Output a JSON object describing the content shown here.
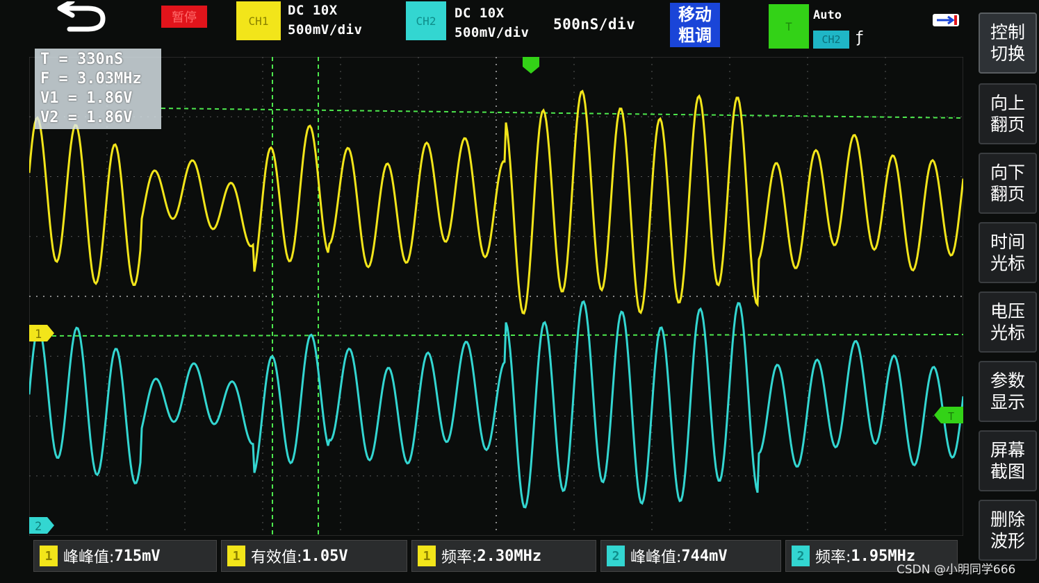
{
  "top_bar": {
    "pause_label": "暂停",
    "ch1_label": "CH1",
    "ch1_coupling": "DC 10X",
    "ch1_scale": "500mV/div",
    "ch2_label": "CH2",
    "ch2_coupling": "DC 10X",
    "ch2_scale": "500mV/div",
    "timebase": "500nS/div",
    "move_mode_line1": "移动",
    "move_mode_line2": "粗调",
    "trigger_label": "T",
    "trigger_mode": "Auto",
    "trigger_source": "CH2",
    "trigger_edge": "ƒ"
  },
  "cursor_readout": {
    "t": "T = 330nS",
    "f": "F = 3.03MHz",
    "v1": "V1 = 1.86V",
    "v2": "V2 = 1.86V"
  },
  "markers": {
    "ch1": "1",
    "ch2": "2",
    "trigger": "T"
  },
  "side_menu": [
    {
      "line1": "控制",
      "line2": "切换"
    },
    {
      "line1": "向上",
      "line2": "翻页"
    },
    {
      "line1": "向下",
      "line2": "翻页"
    },
    {
      "line1": "时间",
      "line2": "光标"
    },
    {
      "line1": "电压",
      "line2": "光标"
    },
    {
      "line1": "参数",
      "line2": "显示"
    },
    {
      "line1": "屏幕",
      "line2": "截图"
    },
    {
      "line1": "删除",
      "line2": "波形"
    }
  ],
  "measurements": [
    {
      "channel": "1",
      "label": "峰峰值:",
      "value": "715mV"
    },
    {
      "channel": "1",
      "label": "有效值:",
      "value": "1.05V"
    },
    {
      "channel": "1",
      "label": "频率:",
      "value": "2.30MHz"
    },
    {
      "channel": "2",
      "label": "峰峰值:",
      "value": "744mV"
    },
    {
      "channel": "2",
      "label": "频率:",
      "value": "1.95MHz"
    }
  ],
  "watermark": "CSDN @小明同学666",
  "colors": {
    "ch1": "#f2e51a",
    "ch2": "#33d6d1",
    "trigger": "#33d217",
    "cursor": "#4de84d",
    "pause": "#e1141b",
    "move": "#1a45d8"
  }
}
